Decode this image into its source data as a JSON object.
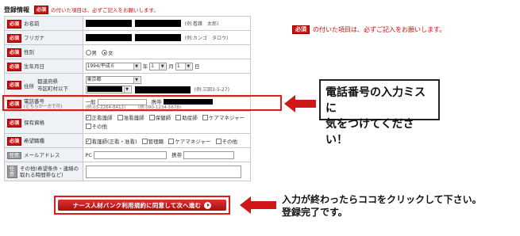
{
  "header": {
    "title": "登録情報",
    "required_badge": "必須",
    "note": "の付いた項目は、必ずご記入をお願いします。"
  },
  "form": {
    "required_badge": "必須",
    "optional_badge": "任意",
    "name": {
      "label": "お名前",
      "hint": "(例:看護　太郎)"
    },
    "furigana": {
      "label": "フリガナ",
      "hint": "(例:カンゴ　タロウ)"
    },
    "gender": {
      "label": "性別",
      "options": [
        "男",
        "女"
      ],
      "selected": "女"
    },
    "birthdate": {
      "label": "生年月日",
      "year_value": "1994/平成６",
      "year_unit": "年",
      "month_value": "1",
      "month_unit": "月",
      "day_value": "1",
      "day_unit": "日"
    },
    "address": {
      "label": "住所",
      "prefecture_label": "都道府県",
      "city_label": "市区町村以下",
      "prefecture_value": "東京都",
      "hint": "(例:三田3-5-27)"
    },
    "phone": {
      "label": "電話番号",
      "sublabel": "(どちらか一方で可)",
      "landline_label": "一般",
      "landline_hint": "(例:03-2264-8412)",
      "mobile_label": "携帯",
      "mobile_hint": "(例:090-1234-5678)"
    },
    "license": {
      "label": "保有資格",
      "options": [
        {
          "label": "正看護師",
          "checked": true
        },
        {
          "label": "准看護師",
          "checked": false
        },
        {
          "label": "保健師",
          "checked": false
        },
        {
          "label": "助産師",
          "checked": false
        },
        {
          "label": "ケアマネジャー",
          "checked": false
        },
        {
          "label": "その他",
          "checked": false
        }
      ]
    },
    "desired_job": {
      "label": "希望職種",
      "options": [
        {
          "label": "看護師(正看・准看)",
          "checked": true
        },
        {
          "label": "管理職",
          "checked": false
        },
        {
          "label": "ケアマネジャー",
          "checked": false
        },
        {
          "label": "その他",
          "checked": false
        }
      ]
    },
    "email": {
      "label": "メールアドレス",
      "pc_label": "PC",
      "mobile_label": "携帯"
    },
    "other": {
      "label": "その他(希望条件・連絡の取れる時間帯など)"
    }
  },
  "side_note": {
    "badge": "必須",
    "text": "の付いた項目は、必ずご記入をお願いします。"
  },
  "callout": {
    "line1": "電話番号の入力ミスに",
    "line2": "気をつけてください！"
  },
  "submit": {
    "label": "ナース人材バンク利用規約に同意して次へ進む"
  },
  "bottom_note": {
    "line1": "入力が終わったらココをクリックして下さい。",
    "line2": "登録完了です。"
  },
  "colors": {
    "accent": "#e31b1b",
    "required_badge": "#cc1111",
    "label_bg": "#eef1f5"
  }
}
